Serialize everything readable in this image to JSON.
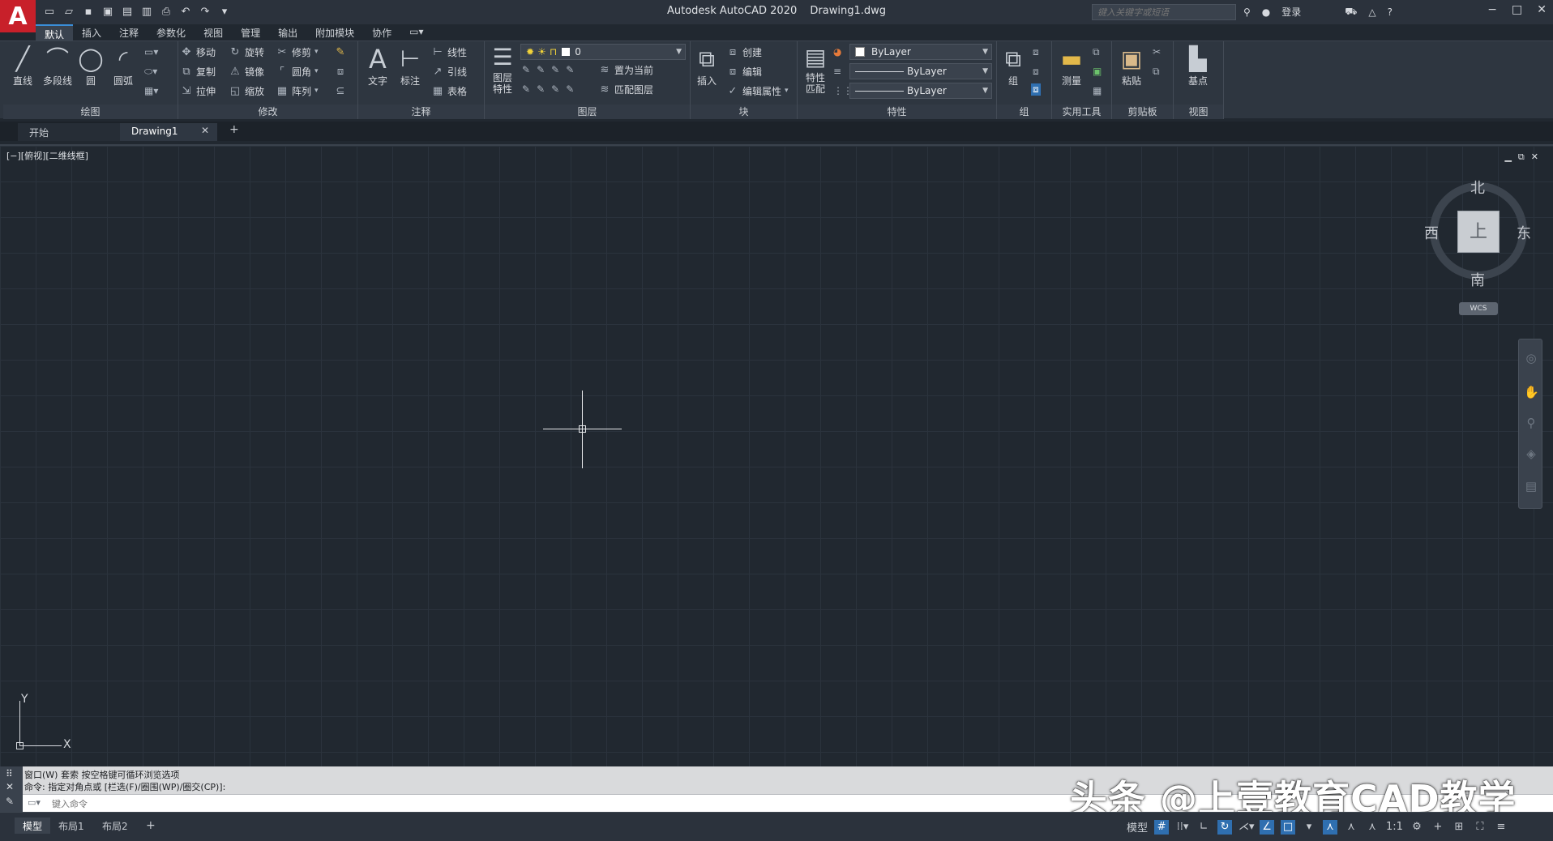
{
  "app": {
    "logo_letter": "A",
    "product": "Autodesk AutoCAD 2020",
    "filename": "Drawing1.dwg"
  },
  "search": {
    "placeholder": "键入关键字或短语"
  },
  "user": {
    "login_label": "登录"
  },
  "ribbon_tabs": [
    "默认",
    "插入",
    "注释",
    "参数化",
    "视图",
    "管理",
    "输出",
    "附加模块",
    "协作"
  ],
  "ribbon": {
    "draw": {
      "title": "绘图",
      "line": "直线",
      "polyline": "多段线",
      "circle": "圆",
      "arc": "圆弧"
    },
    "modify": {
      "title": "修改",
      "move": "移动",
      "rotate": "旋转",
      "trim": "修剪",
      "copy": "复制",
      "mirror": "镜像",
      "fillet": "圆角",
      "stretch": "拉伸",
      "scale": "缩放",
      "array": "阵列"
    },
    "annotation": {
      "title": "注释",
      "text": "文字",
      "dimension": "标注",
      "linear": "线性",
      "leader": "引线",
      "table": "表格"
    },
    "layers": {
      "title": "图层",
      "layer_properties_1": "图层",
      "layer_properties_2": "特性",
      "current_layer": "0",
      "set_current": "置为当前",
      "match_layer": "匹配图层"
    },
    "block": {
      "title": "块",
      "insert": "插入",
      "create": "创建",
      "edit": "编辑",
      "edit_attributes": "编辑属性"
    },
    "properties": {
      "title": "特性",
      "match_1": "特性",
      "match_2": "匹配",
      "color": "ByLayer",
      "linetype": "ByLayer",
      "lineweight": "ByLayer"
    },
    "groups": {
      "title": "组",
      "group": "组"
    },
    "utilities": {
      "title": "实用工具",
      "measure": "测量"
    },
    "clipboard": {
      "title": "剪贴板",
      "paste": "粘贴"
    },
    "view": {
      "title": "视图",
      "base": "基点"
    }
  },
  "doc_tabs": {
    "start": "开始",
    "drawing": "Drawing1"
  },
  "viewport": {
    "label": "[−][俯视][二维线框]",
    "viewcube_face": "上",
    "north": "北",
    "south": "南",
    "east": "东",
    "west": "西",
    "wcs": "WCS",
    "ucs_x": "X",
    "ucs_y": "Y"
  },
  "command": {
    "history_1": "窗口(W) 套索  按空格键可循环浏览选项",
    "history_2": "命令: 指定对角点或 [栏选(F)/圈围(WP)/圈交(CP)]:",
    "input_placeholder": "键入命令"
  },
  "watermark": "头条 @上壹教育CAD教学",
  "status": {
    "model_tab": "模型",
    "layout1": "布局1",
    "layout2": "布局2",
    "model_label": "模型",
    "scale": "1:1"
  },
  "colors": {
    "accent": "#3a8ed8",
    "logo": "#c8202a",
    "canvas": "#212830"
  }
}
